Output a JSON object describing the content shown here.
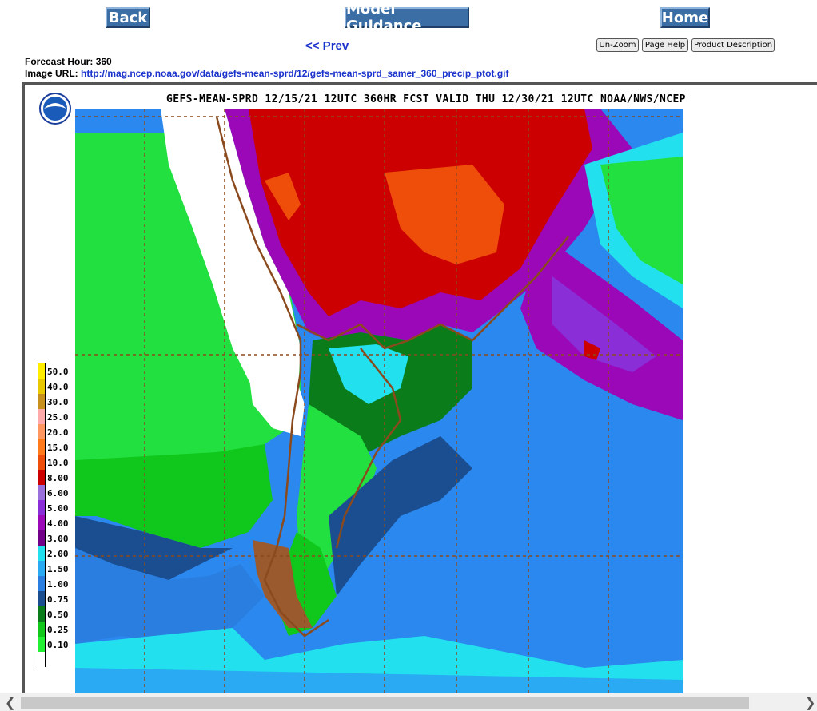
{
  "nav": {
    "back_label": "Back",
    "guidance_label": "Model Guidance",
    "home_label": "Home",
    "prev_label": "<< Prev"
  },
  "toolbar": {
    "unzoom_label": "Un-Zoom",
    "page_help_label": "Page Help",
    "product_description_label": "Product Description"
  },
  "meta": {
    "forecast_hour_label": "Forecast Hour:",
    "forecast_hour_value": "360",
    "image_url_label": "Image URL:",
    "image_url_value": "http://mag.ncep.noaa.gov/data/gefs-mean-sprd/12/gefs-mean-sprd_samer_360_precip_ptot.gif"
  },
  "map": {
    "title": "GEFS-MEAN-SPRD 12/15/21 12UTC 360HR FCST VALID THU 12/30/21 12UTC NOAA/NWS/NCEP",
    "logo_text": "NOAA",
    "legend": [
      {
        "label": "50.0",
        "color": "#ffee00"
      },
      {
        "label": "40.0",
        "color": "#e8c800"
      },
      {
        "label": "30.0",
        "color": "#c8901c"
      },
      {
        "label": "25.0",
        "color": "#ffaaaa"
      },
      {
        "label": "20.0",
        "color": "#ff9860"
      },
      {
        "label": "15.0",
        "color": "#ff7a1a"
      },
      {
        "label": "10.0",
        "color": "#ee4e0a"
      },
      {
        "label": "8.00",
        "color": "#cc0000"
      },
      {
        "label": "6.00",
        "color": "#9a70dd"
      },
      {
        "label": "5.00",
        "color": "#8a2ed8"
      },
      {
        "label": "4.00",
        "color": "#9a08b8"
      },
      {
        "label": "3.00",
        "color": "#730088"
      },
      {
        "label": "2.00",
        "color": "#22e0ee"
      },
      {
        "label": "1.50",
        "color": "#2aaaf2"
      },
      {
        "label": "1.00",
        "color": "#2a7ee0"
      },
      {
        "label": "0.75",
        "color": "#1a4e90"
      },
      {
        "label": "0.50",
        "color": "#0a7d1a"
      },
      {
        "label": "0.25",
        "color": "#11c81b"
      },
      {
        "label": "0.10",
        "color": "#22f033"
      },
      {
        "label": "",
        "color": "#ffffff"
      }
    ]
  }
}
